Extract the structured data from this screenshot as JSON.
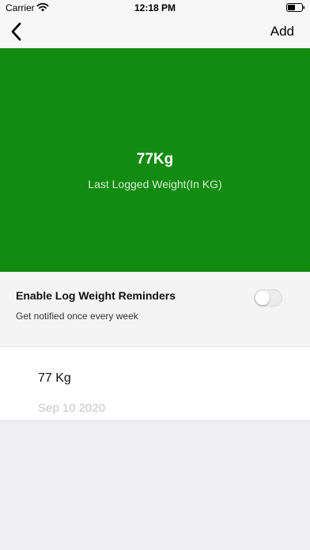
{
  "status_bar": {
    "carrier": "Carrier",
    "time": "12:18 PM",
    "icons": [
      "wifi-icon",
      "battery-icon"
    ]
  },
  "nav": {
    "back_icon": "chevron-left-icon",
    "add_label": "Add"
  },
  "hero": {
    "value": "77Kg",
    "caption": "Last Logged Weight(In KG)",
    "color": "#138b12"
  },
  "reminder": {
    "title": "Enable Log Weight Reminders",
    "subtitle": "Get notified once every week",
    "enabled": false
  },
  "log_entries": [
    {
      "weight": "77 Kg",
      "date": "Sep 10 2020"
    }
  ]
}
